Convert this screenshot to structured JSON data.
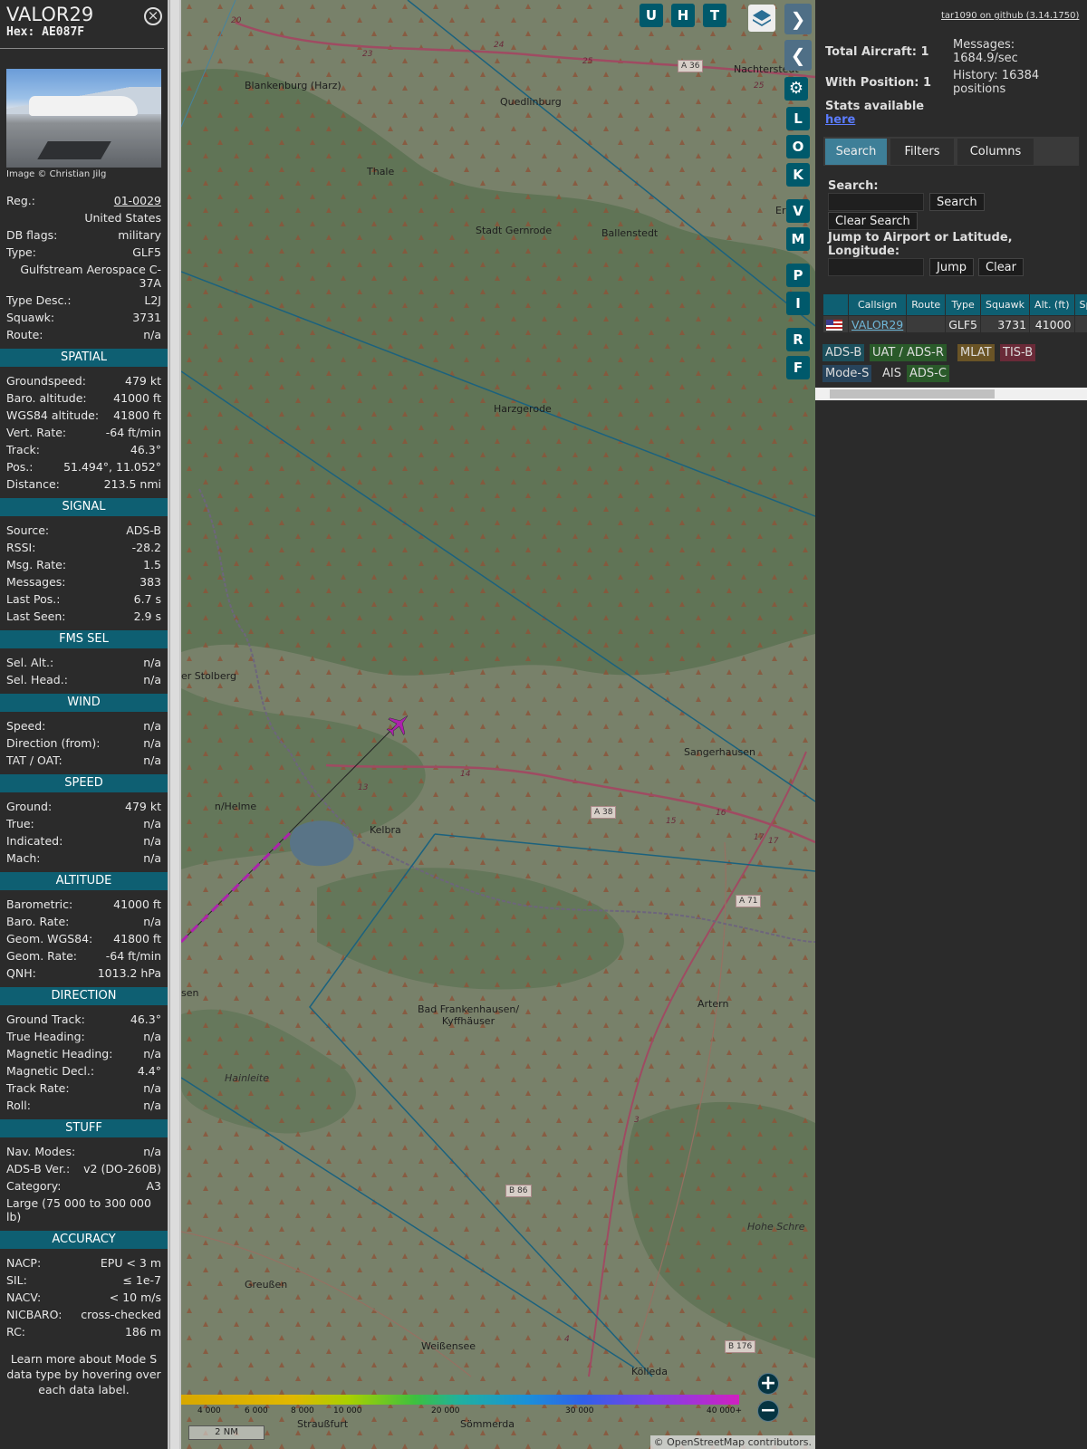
{
  "aircraft": {
    "callsign": "VALOR29",
    "hex_label": "Hex: AE087F",
    "photo_credit": "Image © Christian Jilg",
    "info_rows": [
      {
        "k": "Reg.:",
        "v": "01-0029"
      },
      {
        "k": "",
        "v": "United States"
      },
      {
        "k": "DB flags:",
        "v": "military"
      },
      {
        "k": "Type:",
        "v": "GLF5"
      },
      {
        "k": "",
        "v": "Gulfstream Aerospace C-37A"
      },
      {
        "k": "Type Desc.:",
        "v": "L2J"
      },
      {
        "k": "Squawk:",
        "v": "3731"
      },
      {
        "k": "Route:",
        "v": "n/a"
      }
    ],
    "sections": [
      {
        "title": "SPATIAL",
        "rows": [
          {
            "k": "Groundspeed:",
            "v": "479 kt"
          },
          {
            "k": "Baro. altitude:",
            "v": "41000 ft"
          },
          {
            "k": "WGS84 altitude:",
            "v": "41800 ft"
          },
          {
            "k": "Vert. Rate:",
            "v": "-64 ft/min"
          },
          {
            "k": "Track:",
            "v": "46.3°"
          },
          {
            "k": "Pos.:",
            "v": "51.494°, 11.052°"
          },
          {
            "k": "Distance:",
            "v": "213.5 nmi"
          }
        ]
      },
      {
        "title": "SIGNAL",
        "rows": [
          {
            "k": "Source:",
            "v": "ADS-B"
          },
          {
            "k": "RSSI:",
            "v": "-28.2"
          },
          {
            "k": "Msg. Rate:",
            "v": "1.5"
          },
          {
            "k": "Messages:",
            "v": "383"
          },
          {
            "k": "Last Pos.:",
            "v": "6.7 s"
          },
          {
            "k": "Last Seen:",
            "v": "2.9 s"
          }
        ]
      },
      {
        "title": "FMS SEL",
        "rows": [
          {
            "k": "Sel. Alt.:",
            "v": "n/a"
          },
          {
            "k": "Sel. Head.:",
            "v": "n/a"
          }
        ]
      },
      {
        "title": "WIND",
        "rows": [
          {
            "k": "Speed:",
            "v": "n/a"
          },
          {
            "k": "Direction (from):",
            "v": "n/a"
          },
          {
            "k": "TAT / OAT:",
            "v": "n/a"
          }
        ]
      },
      {
        "title": "SPEED",
        "rows": [
          {
            "k": "Ground:",
            "v": "479 kt"
          },
          {
            "k": "True:",
            "v": "n/a"
          },
          {
            "k": "Indicated:",
            "v": "n/a"
          },
          {
            "k": "Mach:",
            "v": "n/a"
          }
        ]
      },
      {
        "title": "ALTITUDE",
        "rows": [
          {
            "k": "Barometric:",
            "v": "41000 ft"
          },
          {
            "k": "Baro. Rate:",
            "v": "n/a"
          },
          {
            "k": "Geom. WGS84:",
            "v": "41800 ft"
          },
          {
            "k": "Geom. Rate:",
            "v": "-64 ft/min"
          },
          {
            "k": "QNH:",
            "v": "1013.2 hPa"
          }
        ]
      },
      {
        "title": "DIRECTION",
        "rows": [
          {
            "k": "Ground Track:",
            "v": "46.3°"
          },
          {
            "k": "True Heading:",
            "v": "n/a"
          },
          {
            "k": "Magnetic Heading:",
            "v": "n/a"
          },
          {
            "k": "Magnetic Decl.:",
            "v": "4.4°"
          },
          {
            "k": "Track Rate:",
            "v": "n/a"
          },
          {
            "k": "Roll:",
            "v": "n/a"
          }
        ]
      },
      {
        "title": "STUFF",
        "rows": [
          {
            "k": "Nav. Modes:",
            "v": "n/a"
          },
          {
            "k": "ADS-B Ver.:",
            "v": "v2 (DO-260B)"
          },
          {
            "k": "Category:",
            "v": "A3"
          },
          {
            "k": "Large (75 000 to 300 000 lb)",
            "v": ""
          }
        ]
      },
      {
        "title": "ACCURACY",
        "rows": [
          {
            "k": "NACP:",
            "v": "EPU < 3 m"
          },
          {
            "k": "SIL:",
            "v": "≤ 1e-7"
          },
          {
            "k": "NACV:",
            "v": "< 10 m/s"
          },
          {
            "k": "NICBARO:",
            "v": "cross-checked"
          },
          {
            "k": "RC:",
            "v": "186 m"
          }
        ]
      }
    ],
    "learn_more": "Learn more about Mode S data type by hovering over each data label."
  },
  "map": {
    "labels": [
      {
        "t": "Blankenburg (Harz)",
        "c": "town"
      },
      {
        "t": "Quedlinburg",
        "c": "town"
      },
      {
        "t": "Nachterstedt",
        "c": "town"
      },
      {
        "t": "Thale",
        "c": "town"
      },
      {
        "t": "Stadt Gernrode",
        "c": "town"
      },
      {
        "t": "Ballenstedt",
        "c": "town"
      },
      {
        "t": "Erm",
        "c": "town"
      },
      {
        "t": "Harzgerode",
        "c": "town"
      },
      {
        "t": "er Stolberg",
        "c": "town"
      },
      {
        "t": "Sangerhausen",
        "c": "town"
      },
      {
        "t": "n/Helme",
        "c": "town"
      },
      {
        "t": "Kelbra",
        "c": "town"
      },
      {
        "t": "sen",
        "c": "town"
      },
      {
        "t": "Bad Frankenhausen/ Kyffhäuser",
        "c": "town"
      },
      {
        "t": "Artern",
        "c": "town"
      },
      {
        "t": "Hainleite",
        "c": "region"
      },
      {
        "t": "Hohe Schre",
        "c": "region"
      },
      {
        "t": "Greußen",
        "c": "town"
      },
      {
        "t": "Weißensee",
        "c": "town"
      },
      {
        "t": "Kölleda",
        "c": "town"
      },
      {
        "t": "Straußfurt",
        "c": "town"
      },
      {
        "t": "Sömmerda",
        "c": "town"
      }
    ],
    "road_shields": [
      "A 36",
      "A 38",
      "A 71",
      "B 86",
      "B 176"
    ],
    "road_numbers": [
      "20",
      "23",
      "24",
      "25",
      "25",
      "13",
      "14",
      "15",
      "16",
      "17",
      "17",
      "3",
      "4"
    ],
    "toolbar_top": [
      "U",
      "H",
      "T"
    ],
    "toolbar_side": [
      "L",
      "O",
      "K",
      "V",
      "M",
      "P",
      "I",
      "R",
      "F"
    ],
    "legend": [
      "4 000",
      "6 000",
      "8 000",
      "10 000",
      "20 000",
      "30 000",
      "40 000+"
    ],
    "scale": "2 NM",
    "attribution": "© OpenStreetMap contributors."
  },
  "panel": {
    "github": "tar1090 on github (3.14.1750)",
    "total_aircraft": "Total Aircraft: 1",
    "with_position": "With Position: 1",
    "messages": "Messages: 1684.9/sec",
    "history": "History: 16384 positions",
    "stats_label": "Stats available",
    "stats_link": "here",
    "tabs": [
      "Search",
      "Filters",
      "Columns"
    ],
    "search_label": "Search:",
    "search_btn": "Search",
    "clear_search_btn": "Clear Search",
    "jump_label": "Jump to Airport or Latitude, Longitude:",
    "jump_btn": "Jump",
    "clear_btn": "Clear",
    "columns": [
      "",
      "Callsign",
      "Route",
      "Type",
      "Squawk",
      "Alt. (ft)",
      "Spd"
    ],
    "rows": [
      {
        "callsign": "VALOR29",
        "route": "",
        "type": "GLF5",
        "squawk": "3731",
        "alt": "41000",
        "spd": ""
      }
    ],
    "sources": [
      {
        "t": "ADS-B",
        "color": "#1c4f5c"
      },
      {
        "t": "UAT / ADS-R",
        "color": "#2a5a2a"
      },
      {
        "t": "MLAT",
        "color": "#6a5426"
      },
      {
        "t": "TIS-B",
        "color": "#6a2a38"
      },
      {
        "t": "Mode-S",
        "color": "#27445c"
      },
      {
        "t": "AIS",
        "color": "#2b2b2b"
      },
      {
        "t": "ADS-C",
        "color": "#2a5a2a"
      }
    ]
  },
  "colors": {
    "accent": "#0e5f72",
    "aircraft": "#c020c0",
    "airspace": "#1a6a8a"
  }
}
